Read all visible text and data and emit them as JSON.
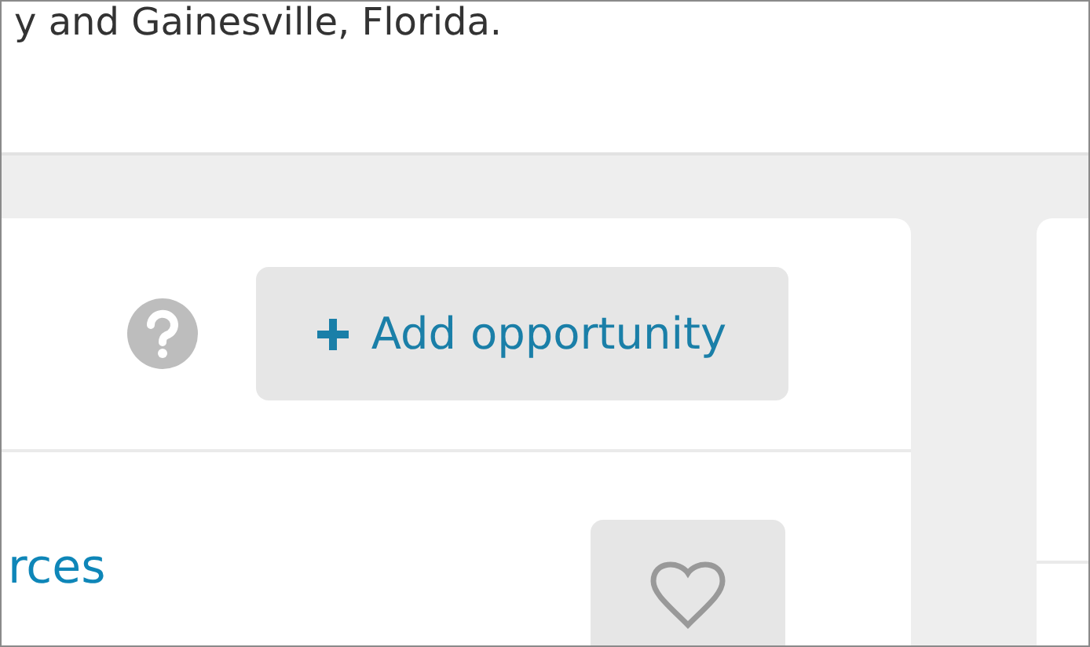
{
  "intro": {
    "text": "y and Gainesville, Florida."
  },
  "opportunities": {
    "add_button": {
      "label": "Add opportunity"
    },
    "items": [
      {
        "title": "rces",
        "favorite": false
      }
    ]
  }
}
